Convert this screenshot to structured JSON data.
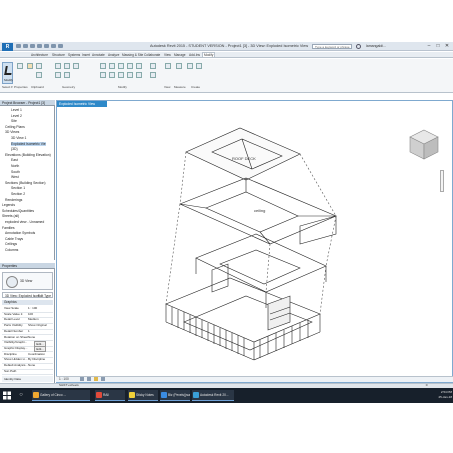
{
  "titlebar": {
    "app_letter": "R",
    "title": "Autodesk Revit 2015 - STUDENT VERSION - Project1 [3] - 3D View: Exploded Isometric View",
    "search_placeholder": "Type a keyword or phrase",
    "user": "lamangaldi...",
    "minimize": "–",
    "maximize": "□",
    "close": "✕"
  },
  "ribbon": {
    "tabs": [
      "Architecture",
      "Structure",
      "Systems",
      "Insert",
      "Annotate",
      "Analyze",
      "Massing & Site",
      "Collaborate",
      "View",
      "Manage",
      "Add-Ins",
      "Modify"
    ],
    "active_tab": "Modify",
    "modify_label": "Modify",
    "groups": [
      "Select ▾",
      "Properties",
      "Clipboard",
      "Geometry",
      "Modify",
      "View",
      "Measure",
      "Create"
    ]
  },
  "project_browser": {
    "title": "Project Browser - Project1 [3]",
    "items": [
      {
        "label": "Level 1",
        "indent": 3
      },
      {
        "label": "Level 2",
        "indent": 3
      },
      {
        "label": "Site",
        "indent": 3
      },
      {
        "label": "Ceiling Plans",
        "indent": 1
      },
      {
        "label": "3D Views",
        "indent": 1
      },
      {
        "label": "3D View 1",
        "indent": 3
      },
      {
        "label": "Exploded Isometric Vie",
        "indent": 3,
        "selected": true
      },
      {
        "label": "{3D}",
        "indent": 3
      },
      {
        "label": "Elevations (Building Elevation)",
        "indent": 1
      },
      {
        "label": "East",
        "indent": 3
      },
      {
        "label": "North",
        "indent": 3
      },
      {
        "label": "South",
        "indent": 3
      },
      {
        "label": "West",
        "indent": 3
      },
      {
        "label": "Sections (Building Section)",
        "indent": 1
      },
      {
        "label": "Section 1",
        "indent": 3
      },
      {
        "label": "Section 2",
        "indent": 3
      },
      {
        "label": "Renderings",
        "indent": 1
      },
      {
        "label": "Legends",
        "indent": 0
      },
      {
        "label": "Schedules/Quantities",
        "indent": 0
      },
      {
        "label": "Sheets (all)",
        "indent": 0
      },
      {
        "label": "exploded view - Unnamed",
        "indent": 1
      },
      {
        "label": "Families",
        "indent": 0
      },
      {
        "label": "Annotation Symbols",
        "indent": 1
      },
      {
        "label": "Cable Trays",
        "indent": 1
      },
      {
        "label": "Ceilings",
        "indent": 1
      },
      {
        "label": "Columns",
        "indent": 1
      }
    ]
  },
  "properties": {
    "title": "Properties",
    "type_name": "3D View",
    "type_row": "3D View: Exploded Isom",
    "edit_type": "Edit Type",
    "section": "Graphics",
    "rows": [
      {
        "name": "View Scale",
        "value": "1 : 100"
      },
      {
        "name": "Scale Value 1:",
        "value": "100"
      },
      {
        "name": "Detail Level",
        "value": "Medium"
      },
      {
        "name": "Parts Visibility",
        "value": "Show Original"
      },
      {
        "name": "Detail Number",
        "value": "1"
      },
      {
        "name": "Rotation on Sheet",
        "value": "None"
      },
      {
        "name": "Visibility/Graphi...",
        "button": "Edit..."
      },
      {
        "name": "Graphic Display...",
        "button": "Edit..."
      },
      {
        "name": "Discipline",
        "value": "Coordination"
      },
      {
        "name": "Show Hidden Li...",
        "value": "By Discipline"
      },
      {
        "name": "Default Analysis...",
        "value": "None"
      },
      {
        "name": "Sun Path",
        "value": ""
      }
    ],
    "footer": "Identity Data"
  },
  "view": {
    "tab_title": "Exploded Isometric View",
    "scale": "1 : 100",
    "labels": {
      "roof": "ROOF DECK",
      "ceiling": "ceiling"
    }
  },
  "status": {
    "text": "SHIFT+wheels",
    "filter": ":0"
  },
  "taskbar": {
    "buttons": [
      {
        "label": "Gallery of Cinco ..."
      },
      {
        "label": "RAII"
      },
      {
        "label": "Sticky Notes"
      },
      {
        "label": "Biz (Pexels)(sun) ..."
      },
      {
        "label": "Autodesk Revit 20..."
      }
    ],
    "time": "2:54 PM",
    "date": "25-Jan-18"
  }
}
